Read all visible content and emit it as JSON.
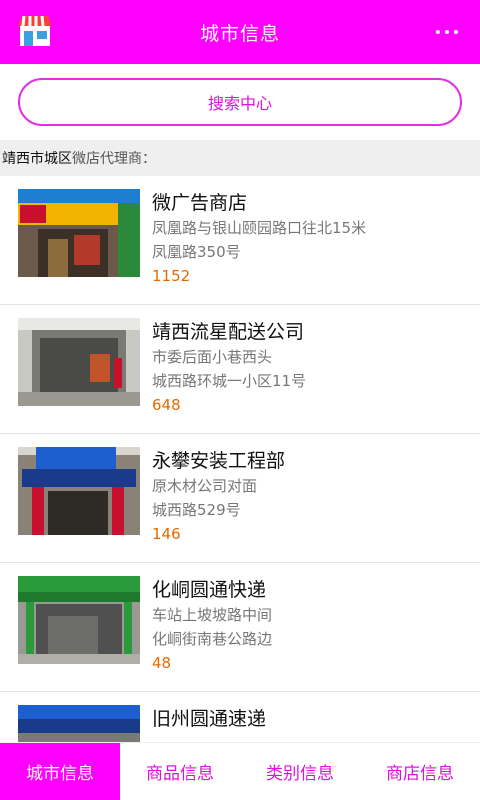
{
  "header": {
    "title": "城市信息",
    "logo_icon": "store-icon",
    "menu_icon": "more-dots-icon"
  },
  "search": {
    "label": "搜索中心"
  },
  "section": {
    "city": "靖西市城区",
    "label": "微店代理商："
  },
  "stores": [
    {
      "name": "微广告商店",
      "address1": "凤凰路与银山颐园路口往北15米",
      "address2": "凤凰路350号",
      "count": "1152"
    },
    {
      "name": "靖西流星配送公司",
      "address1": "市委后面小巷西头",
      "address2": "城西路环城一小区11号",
      "count": "648"
    },
    {
      "name": "永攀安装工程部",
      "address1": "原木材公司对面",
      "address2": "城西路529号",
      "count": "146"
    },
    {
      "name": "化峒圆通快递",
      "address1": "车站上坡坡路中间",
      "address2": "化峒街南巷公路边",
      "count": "48"
    },
    {
      "name": "旧州圆通速递",
      "address1": "",
      "address2": "",
      "count": ""
    }
  ],
  "tabs": [
    {
      "label": "城市信息",
      "active": true
    },
    {
      "label": "商品信息",
      "active": false
    },
    {
      "label": "类别信息",
      "active": false
    },
    {
      "label": "商店信息",
      "active": false
    }
  ],
  "colors": {
    "accent": "#ff00ff",
    "count": "#e66a00"
  }
}
